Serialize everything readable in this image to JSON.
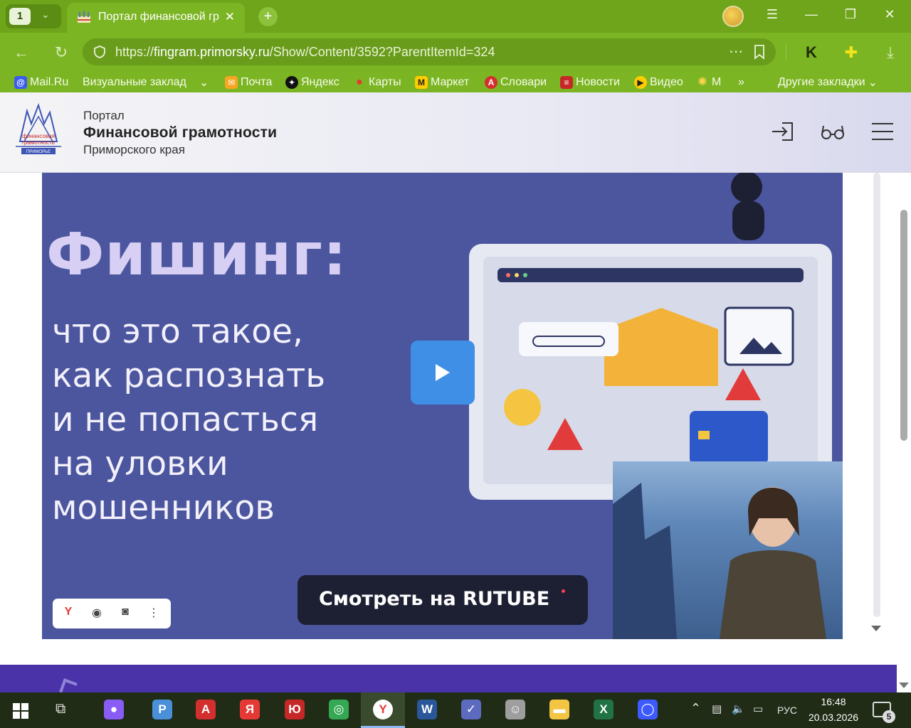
{
  "browser": {
    "tab_count": "1",
    "active_tab_title": "Портал финансовой гр",
    "url_host": "fingram.primorsky.ru",
    "url_prefix": "https://",
    "url_path": "/Show/Content/3592?ParentItemId=324",
    "window_controls": {
      "menu": "☰",
      "minimize": "—",
      "restore": "❐",
      "close": "✕"
    }
  },
  "bookmarks": [
    {
      "label": "Mail.Ru",
      "icon": "mailru-icon",
      "color": "#3a5bf0"
    },
    {
      "label": "Визуальные заклад",
      "icon": "",
      "color": ""
    },
    {
      "label": "Почта",
      "icon": "mail-envelope-icon",
      "color": "#f5a623"
    },
    {
      "label": "Яндекс",
      "icon": "yandex-star-icon",
      "color": "#111111"
    },
    {
      "label": "Карты",
      "icon": "map-pin-icon",
      "color": "#e53935"
    },
    {
      "label": "Маркет",
      "icon": "market-icon",
      "color": "#ffcc00"
    },
    {
      "label": "Словари",
      "icon": "dictionary-icon",
      "color": "#d32f2f"
    },
    {
      "label": "Новости",
      "icon": "news-icon",
      "color": "#c62828"
    },
    {
      "label": "Видео",
      "icon": "video-play-icon",
      "color": "#ffcc00"
    },
    {
      "label": "М",
      "icon": "sun-icon",
      "color": "#ffd54f"
    }
  ],
  "bookmarks_more": "»",
  "bookmarks_other": "Другие закладки",
  "site": {
    "brand_small": "Портал",
    "brand_main": "Финансовой грамотности",
    "brand_region": "Приморского края",
    "logo_text": [
      "финансовая",
      "грамотность",
      "ПРИМОРЬЕ"
    ]
  },
  "video": {
    "headline": "Фишинг:",
    "sublines": [
      "что это такое,",
      "как распознать",
      "и не попасться",
      "на уловки",
      "мошенников"
    ],
    "watch_button": "Смотреть на RUTUBE",
    "accent_color": "#4c569e"
  },
  "taskbar": {
    "language": "РУС",
    "time": "16:48",
    "date": "20.03.2026",
    "notifications": "5",
    "apps": [
      {
        "name": "alice-icon",
        "glyph": "●",
        "color": "#8a5cf6"
      },
      {
        "name": "pdf-viewer-icon",
        "glyph": "P",
        "color": "#4a90d9"
      },
      {
        "name": "acrobat-icon",
        "glyph": "A",
        "color": "#d32f2f"
      },
      {
        "name": "yandex-icon",
        "glyph": "Я",
        "color": "#e53935"
      },
      {
        "name": "yu-app-icon",
        "glyph": "Ю",
        "color": "#c62828"
      },
      {
        "name": "chrome-icon",
        "glyph": "◎",
        "color": "#34a853"
      },
      {
        "name": "yandex-browser-icon",
        "glyph": "Y",
        "color": "#ffffff"
      },
      {
        "name": "word-icon",
        "glyph": "W",
        "color": "#2b579a"
      },
      {
        "name": "checklist-app-icon",
        "glyph": "✓",
        "color": "#5c6bc0"
      },
      {
        "name": "pdf24-icon",
        "glyph": "☺",
        "color": "#9e9e9e"
      },
      {
        "name": "file-explorer-icon",
        "glyph": "▬",
        "color": "#f4c542"
      },
      {
        "name": "excel-icon",
        "glyph": "X",
        "color": "#217346"
      },
      {
        "name": "messenger-icon",
        "glyph": "◯",
        "color": "#3d5afe"
      }
    ]
  }
}
